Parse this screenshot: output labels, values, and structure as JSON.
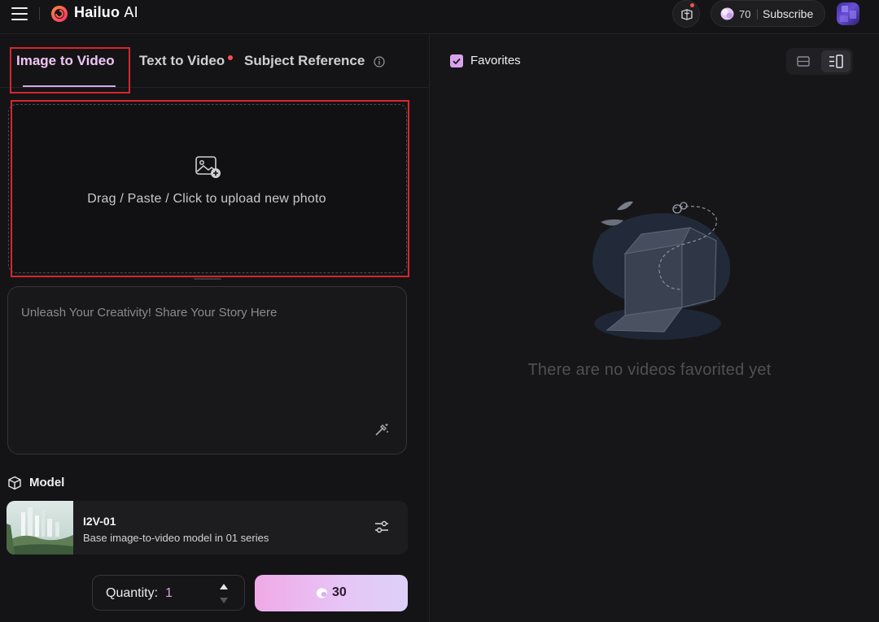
{
  "app": {
    "brand_name": "Hailuo",
    "brand_suffix": "AI"
  },
  "header": {
    "credits": "70",
    "subscribe_label": "Subscribe"
  },
  "tabs": [
    {
      "label": "Image to Video",
      "active": true
    },
    {
      "label": "Text to Video",
      "badge": true
    },
    {
      "label": "Subject Reference",
      "has_info": true
    }
  ],
  "upload": {
    "text": "Drag / Paste / Click to upload new photo"
  },
  "prompt": {
    "placeholder": "Unleash Your Creativity! Share Your Story Here"
  },
  "model": {
    "section_label": "Model",
    "name": "I2V-01",
    "description": "Base image-to-video model in 01 series"
  },
  "quantity": {
    "label": "Quantity:",
    "value": "1"
  },
  "generate": {
    "cost": "30"
  },
  "favorites": {
    "label": "Favorites",
    "checked": true,
    "empty_text": "There are no videos favorited yet"
  },
  "colors": {
    "accent_pink": "#f2c6f5",
    "highlight_red": "#d9252d",
    "badge_red": "#ff4d4f"
  }
}
